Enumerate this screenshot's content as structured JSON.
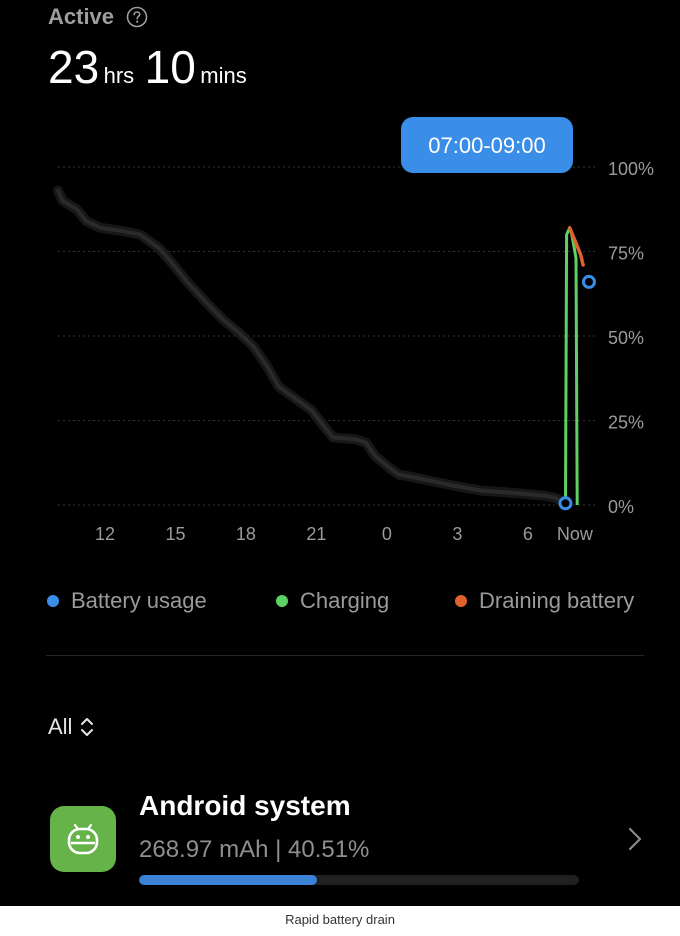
{
  "header": {
    "active_label": "Active",
    "duration": {
      "hours": "23",
      "hours_unit": "hrs",
      "minutes": "10",
      "minutes_unit": "mins"
    }
  },
  "chart_data": {
    "type": "line",
    "tooltip": "07:00-09:00",
    "y_tick_labels": [
      "100%",
      "75%",
      "50%",
      "25%",
      "0%"
    ],
    "y_tick_values": [
      100,
      75,
      50,
      25,
      0
    ],
    "x_tick_labels": [
      "12",
      "15",
      "18",
      "21",
      "0",
      "3",
      "6",
      "Now"
    ],
    "x_tick_values": [
      12,
      15,
      18,
      21,
      24,
      27,
      30,
      32
    ],
    "xlim": [
      10,
      32.9
    ],
    "ylim": [
      0,
      100
    ],
    "grid": true,
    "series": [
      {
        "name": "Battery usage",
        "color": "#2a2a2a",
        "points": [
          [
            10,
            93
          ],
          [
            10.2,
            90
          ],
          [
            10.8,
            87.5
          ],
          [
            11.2,
            84
          ],
          [
            11.8,
            82
          ],
          [
            12.8,
            81
          ],
          [
            13.5,
            80
          ],
          [
            14.3,
            76
          ],
          [
            14.8,
            72
          ],
          [
            15.5,
            66
          ],
          [
            16.3,
            60
          ],
          [
            17,
            55
          ],
          [
            17.7,
            51
          ],
          [
            18.3,
            47
          ],
          [
            18.9,
            41
          ],
          [
            19.4,
            35
          ],
          [
            20.2,
            31
          ],
          [
            20.8,
            28
          ],
          [
            21.3,
            23.5
          ],
          [
            21.7,
            20
          ],
          [
            22.6,
            19.5
          ],
          [
            23.1,
            18.5
          ],
          [
            23.5,
            14.5
          ],
          [
            24.1,
            11
          ],
          [
            24.5,
            9
          ],
          [
            25.3,
            8
          ],
          [
            26.3,
            6.5
          ],
          [
            27,
            5.5
          ],
          [
            28,
            4.3
          ],
          [
            29,
            3.8
          ],
          [
            30,
            3.2
          ],
          [
            30.8,
            2.7
          ],
          [
            31.2,
            2
          ],
          [
            31.6,
            0.5
          ]
        ]
      },
      {
        "name": "Charging",
        "color": "#5fd063",
        "points": [
          [
            31.6,
            0.5
          ],
          [
            31.65,
            80
          ],
          [
            31.78,
            82
          ],
          [
            31.87,
            80
          ],
          [
            31.95,
            77
          ],
          [
            32.05,
            73
          ],
          [
            32.1,
            0
          ]
        ]
      },
      {
        "name": "Draining battery",
        "color": "#e0612b",
        "points": [
          [
            31.78,
            82
          ],
          [
            32.05,
            77.5
          ],
          [
            32.25,
            74
          ],
          [
            32.35,
            71
          ]
        ]
      }
    ],
    "markers": [
      {
        "x": 31.6,
        "y": 0.5
      },
      {
        "x": 32.6,
        "y": 66
      }
    ]
  },
  "legend": [
    {
      "label": "Battery usage",
      "color": "#3b8ee8"
    },
    {
      "label": "Charging",
      "color": "#5fd063"
    },
    {
      "label": "Draining battery",
      "color": "#e0612b"
    }
  ],
  "filter": {
    "label": "All"
  },
  "app": {
    "name": "Android system",
    "stats": "268.97 mAh | 40.51%",
    "usage_fraction": 0.4051
  },
  "caption": "Rapid battery drain"
}
